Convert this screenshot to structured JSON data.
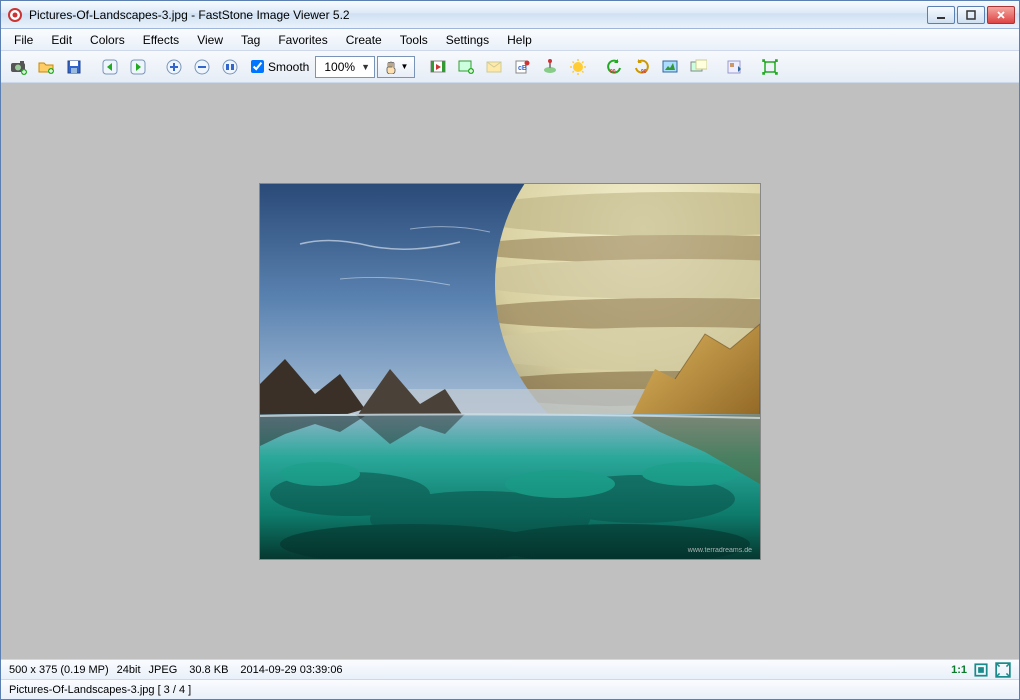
{
  "title": "Pictures-Of-Landscapes-3.jpg  -  FastStone Image Viewer 5.2",
  "menu": [
    "File",
    "Edit",
    "Colors",
    "Effects",
    "View",
    "Tag",
    "Favorites",
    "Create",
    "Tools",
    "Settings",
    "Help"
  ],
  "toolbar": {
    "smooth_label": "Smooth",
    "zoom": "100%"
  },
  "status": {
    "dimensions": "500 x 375 (0.19 MP)",
    "depth": "24bit",
    "format": "JPEG",
    "size": "30.8 KB",
    "datetime": "2014-09-29 03:39:06",
    "ratio": "1:1",
    "filename_index": "Pictures-Of-Landscapes-3.jpg [ 3 / 4 ]"
  }
}
